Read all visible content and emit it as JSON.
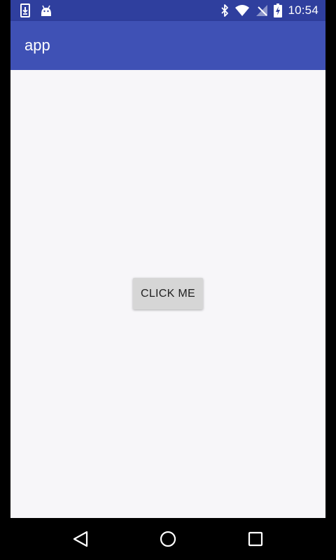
{
  "status_bar": {
    "time": "10:54",
    "left_icons": [
      "download-icon",
      "android-icon"
    ],
    "right_icons": [
      "bluetooth-icon",
      "wifi-icon",
      "no-sim-icon",
      "battery-charging-icon"
    ],
    "background": "#2f3f9e"
  },
  "app_bar": {
    "title": "app",
    "background": "#3f51b5"
  },
  "main": {
    "button_label": "CLICK ME",
    "background": "#f7f6f9"
  },
  "nav_bar": {
    "buttons": [
      "back-icon",
      "home-icon",
      "recents-icon"
    ]
  }
}
